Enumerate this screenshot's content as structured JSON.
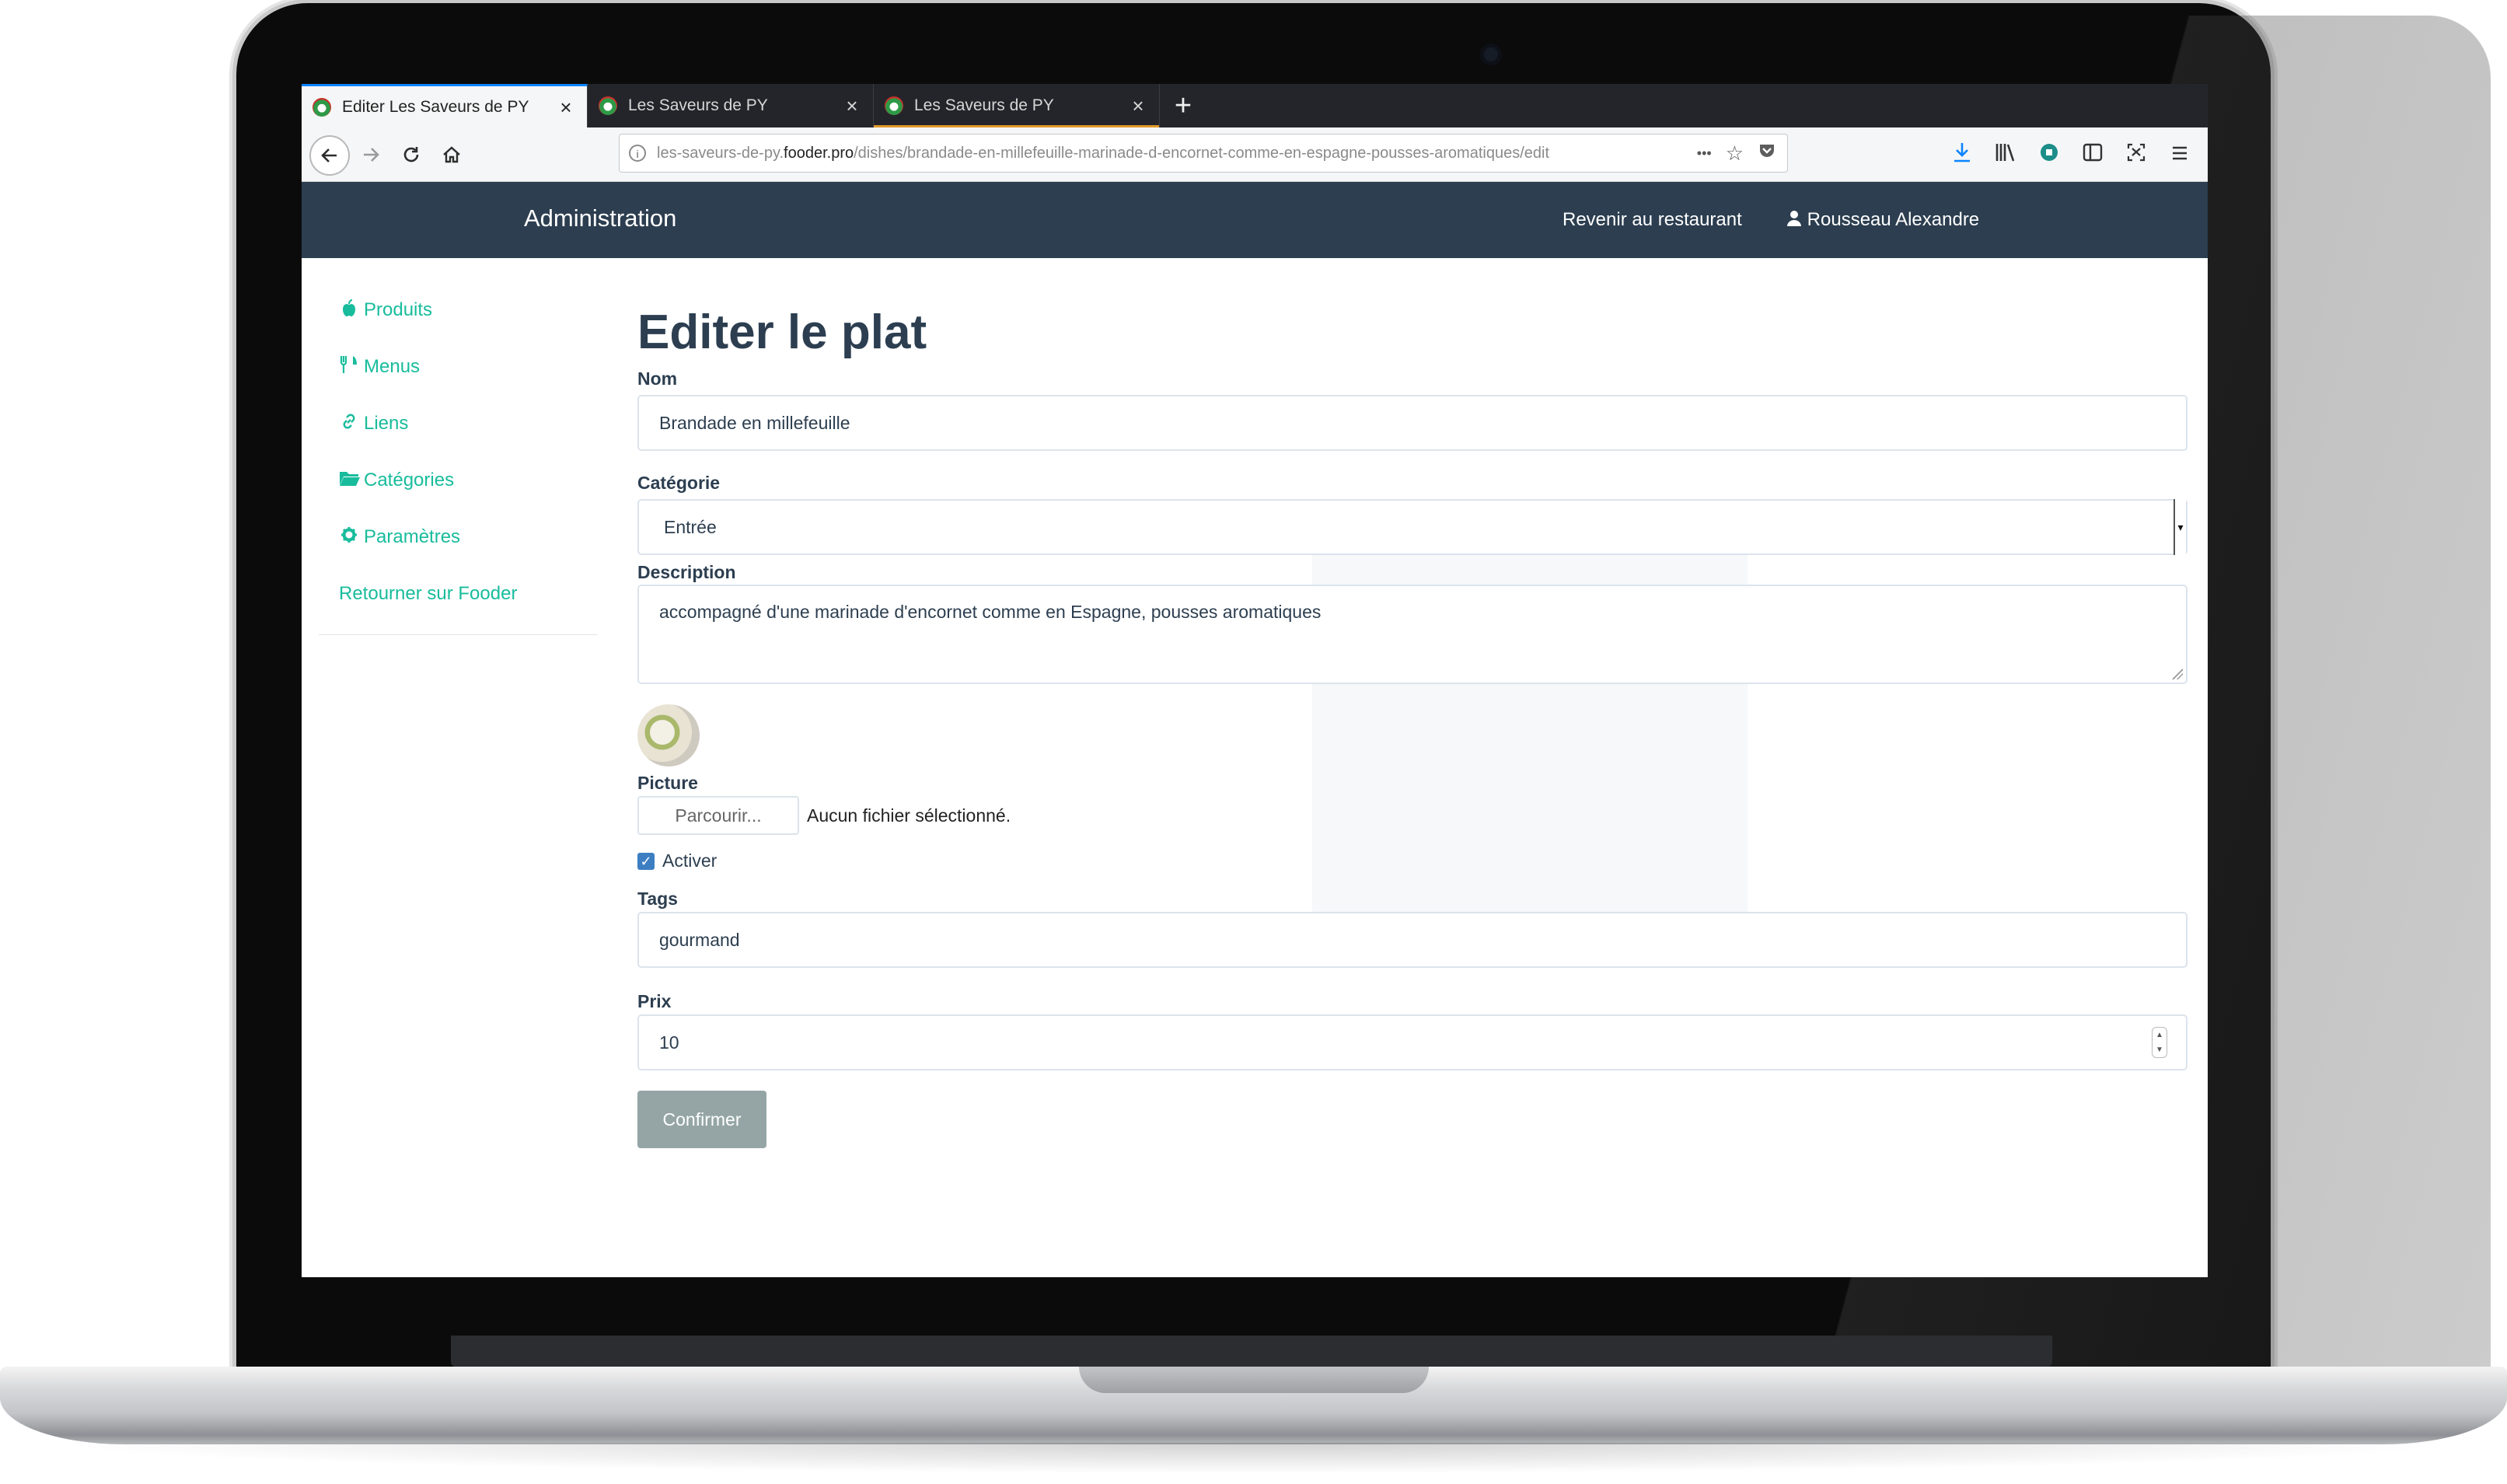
{
  "browser": {
    "tabs": [
      {
        "title": "Editer Les Saveurs de PY",
        "close": "×"
      },
      {
        "title": "Les Saveurs de PY",
        "close": "×"
      },
      {
        "title": "Les Saveurs de PY",
        "close": "×"
      }
    ],
    "new_tab": "+",
    "url": {
      "prefix": "les-saveurs-de-py.",
      "host": "fooder.pro",
      "path": "/dishes/brandade-en-millefeuille-marinade-d-encornet-comme-en-espagne-pousses-aromatiques/edit",
      "more": "•••"
    },
    "icons": [
      "back-icon",
      "forward-icon",
      "reload-icon",
      "home-icon",
      "info-icon",
      "star-icon",
      "pocket-icon",
      "download-icon",
      "library-icon",
      "extension-icon",
      "sidebar-icon",
      "screenshot-icon",
      "menu-icon"
    ]
  },
  "header": {
    "brand": "Administration",
    "back_link": "Revenir au restaurant",
    "user": "Rousseau Alexandre"
  },
  "sidebar": {
    "items": [
      {
        "label": "Produits",
        "icon": "apple-icon"
      },
      {
        "label": "Menus",
        "icon": "cutlery-icon"
      },
      {
        "label": "Liens",
        "icon": "link-icon"
      },
      {
        "label": "Catégories",
        "icon": "folder-icon"
      },
      {
        "label": "Paramètres",
        "icon": "gear-icon"
      },
      {
        "label": "Retourner sur Fooder",
        "icon": ""
      }
    ]
  },
  "form": {
    "title": "Editer le plat",
    "name_label": "Nom",
    "name_value": "Brandade en millefeuille",
    "category_label": "Catégorie",
    "category_value": "Entrée",
    "description_label": "Description",
    "description_value": "accompagné d'une marinade d'encornet comme en Espagne, pousses aromatiques",
    "picture_label": "Picture",
    "browse_button": "Parcourir...",
    "file_status": "Aucun fichier sélectionné.",
    "active_label": "Activer",
    "active_checked": true,
    "tags_label": "Tags",
    "tags_value": "gourmand",
    "price_label": "Prix",
    "price_value": "10",
    "submit": "Confirmer"
  },
  "colors": {
    "header_bg": "#2c3e50",
    "accent": "#18bc9c",
    "button_bg": "#95a5a6",
    "tab_highlight": "#0a84ff"
  }
}
